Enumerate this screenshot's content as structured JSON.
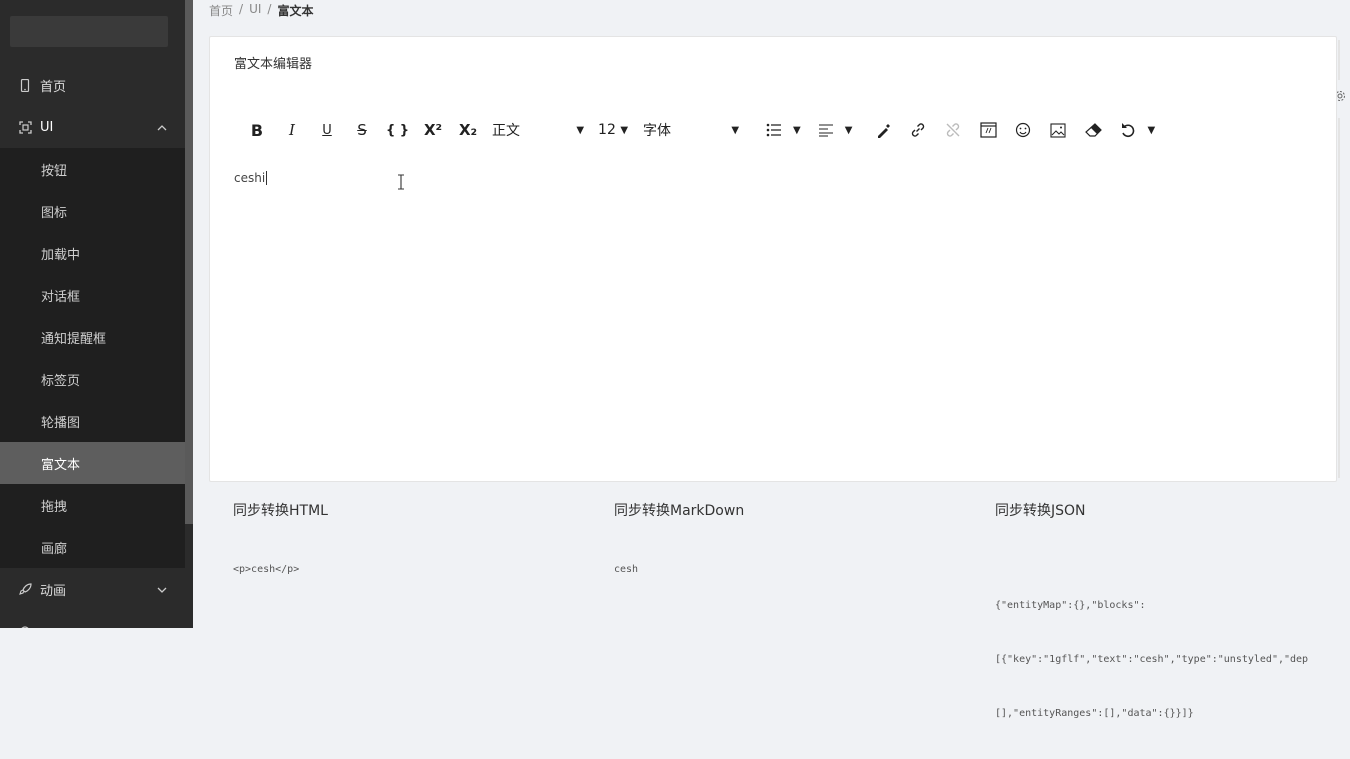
{
  "breadcrumb": {
    "home": "首页",
    "sep1": "/",
    "ui": "UI",
    "sep2": "/",
    "current": "富文本"
  },
  "sidebar": {
    "home": "首页",
    "ui": "UI",
    "sub_items": [
      "按钮",
      "图标",
      "加载中",
      "对话框",
      "通知提醒框",
      "标签页",
      "轮播图",
      "富文本",
      "拖拽",
      "画廊"
    ],
    "active_index": 7,
    "animation": "动画"
  },
  "card": {
    "title": "富文本编辑器"
  },
  "toolbar": {
    "bold": "B",
    "italic": "I",
    "underline": "U",
    "strike": "S",
    "code": "{ }",
    "superscript": "X²",
    "subscript": "X₂",
    "block_type": "正文",
    "font_size": "12",
    "font_family": "字体"
  },
  "editor": {
    "content": "ceshi"
  },
  "conversions": {
    "html_label": "同步转换HTML",
    "markdown_label": "同步转换MarkDown",
    "json_label": "同步转换JSON",
    "html_value": "<p>cesh</p>",
    "markdown_value": "cesh",
    "json_line1": "{\"entityMap\":{},\"blocks\":",
    "json_line2": "[{\"key\":\"1gflf\",\"text\":\"cesh\",\"type\":\"unstyled\",\"dep",
    "json_line3": "[],\"entityRanges\":[],\"data\":{}}]}"
  }
}
